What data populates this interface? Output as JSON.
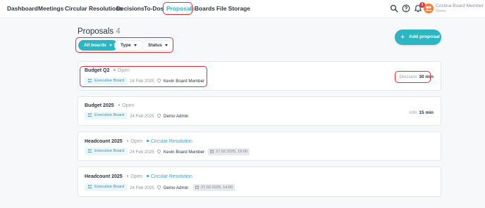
{
  "nav": {
    "items": [
      {
        "label": "Dashboard"
      },
      {
        "label": "Meetings"
      },
      {
        "label": "Circular Resolutions"
      },
      {
        "label": "Decisions"
      },
      {
        "label": "To-Dos"
      },
      {
        "label": "Proposals"
      },
      {
        "label": "Boards"
      },
      {
        "label": "File Storage"
      }
    ],
    "active": "Proposals",
    "notification_count": "2"
  },
  "user": {
    "name": "Cristina Board Member",
    "subtitle": "Demo"
  },
  "page": {
    "title": "Proposals",
    "count": "4"
  },
  "filters": [
    {
      "label": "All boards"
    },
    {
      "label": "Type"
    },
    {
      "label": "Status"
    }
  ],
  "add_button": {
    "label": "Add proposal"
  },
  "proposals": [
    {
      "title": "Budget Q2",
      "status": "Open",
      "tag": "",
      "board": "Executive Board",
      "date": "24 Feb 2025",
      "owner": "Kevin Board Member",
      "deadline": "",
      "right_label": "Decision",
      "right_value": "30 min"
    },
    {
      "title": "Budget 2025",
      "status": "Open",
      "tag": "",
      "board": "Executive Board",
      "date": "24 Feb 2025",
      "owner": "Demo Admin",
      "deadline": "",
      "right_label": "Info",
      "right_value": "15 min"
    },
    {
      "title": "Headcount 2025",
      "status": "Open",
      "tag": "Circular Resolution",
      "board": "Executive Board",
      "date": "24 Feb 2025",
      "owner": "Kevin Board Member",
      "deadline": "27.02.2025, 15:00",
      "right_label": "",
      "right_value": ""
    },
    {
      "title": "Headcount 2025",
      "status": "Open",
      "tag": "Circular Resolution",
      "board": "Executive Board",
      "date": "24 Feb 2025",
      "owner": "Demo Admin",
      "deadline": "27.02.2025, 14:00",
      "right_label": "",
      "right_value": ""
    }
  ],
  "colors": {
    "accent": "#2ab7c3",
    "highlight": "#e0303a",
    "avatar": "#f07f3a"
  }
}
